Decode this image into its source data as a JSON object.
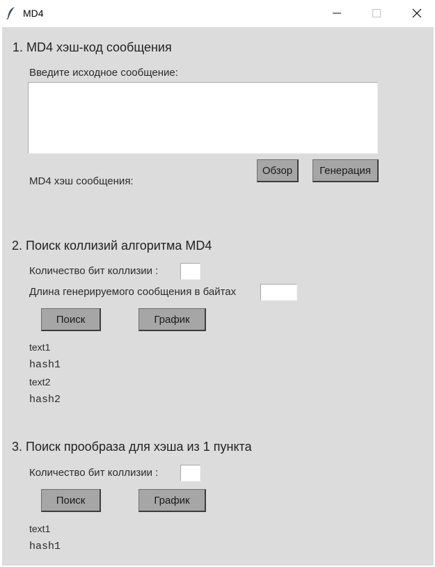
{
  "window": {
    "title": "MD4",
    "icon": "feather-icon"
  },
  "section1": {
    "title": "1. MD4 хэш-код сообщения",
    "input_label": "Введите исходное сообщение:",
    "message_value": "",
    "browse_button": "Обзор",
    "generate_button": "Генерация",
    "hash_label": "MD4 хэш сообщения:"
  },
  "section2": {
    "title": "2. Поиск коллизий алгоритма MD4",
    "bits_label": "Количество бит коллизии :",
    "bits_value": "",
    "length_label": "Длина генерируемого сообщения в байтах",
    "length_value": "",
    "search_button": "Поиск",
    "chart_button": "График",
    "text1": "text1",
    "hash1": "hash1",
    "text2": "text2",
    "hash2": "hash2"
  },
  "section3": {
    "title": "3. Поиск прообраза для хэша из 1 пункта",
    "bits_label": "Количество бит коллизии :",
    "bits_value": "",
    "search_button": "Поиск",
    "chart_button": "График",
    "text1": "text1",
    "hash1": "hash1"
  }
}
